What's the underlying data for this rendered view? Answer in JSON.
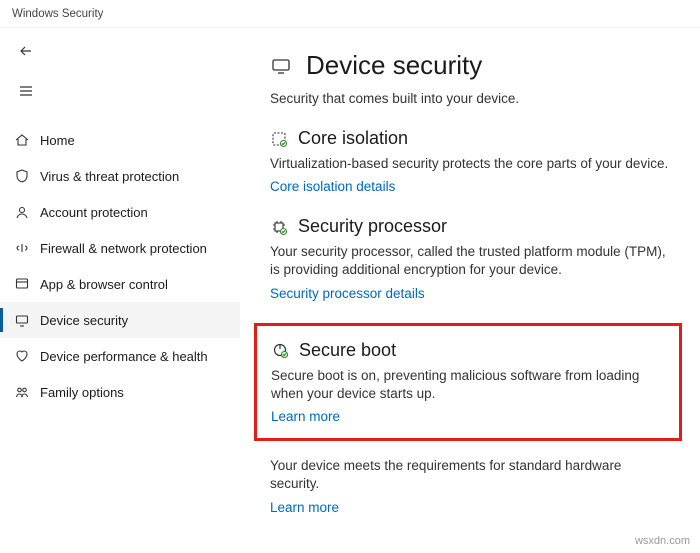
{
  "window": {
    "title": "Windows Security"
  },
  "sidebar": {
    "items": [
      {
        "label": "Home"
      },
      {
        "label": "Virus & threat protection"
      },
      {
        "label": "Account protection"
      },
      {
        "label": "Firewall & network protection"
      },
      {
        "label": "App & browser control"
      },
      {
        "label": "Device security"
      },
      {
        "label": "Device performance & health"
      },
      {
        "label": "Family options"
      }
    ]
  },
  "page": {
    "title": "Device security",
    "subtitle": "Security that comes built into your device."
  },
  "sections": {
    "core": {
      "title": "Core isolation",
      "desc": "Virtualization-based security protects the core parts of your device.",
      "link": "Core isolation details"
    },
    "processor": {
      "title": "Security processor",
      "desc": "Your security processor, called the trusted platform module (TPM), is providing additional encryption for your device.",
      "link": "Security processor details"
    },
    "secureboot": {
      "title": "Secure boot",
      "desc": "Secure boot is on, preventing malicious software from loading when your device starts up.",
      "link": "Learn more"
    },
    "footer": {
      "desc": "Your device meets the requirements for standard hardware security.",
      "link": "Learn more"
    }
  },
  "watermark": "wsxdn.com"
}
